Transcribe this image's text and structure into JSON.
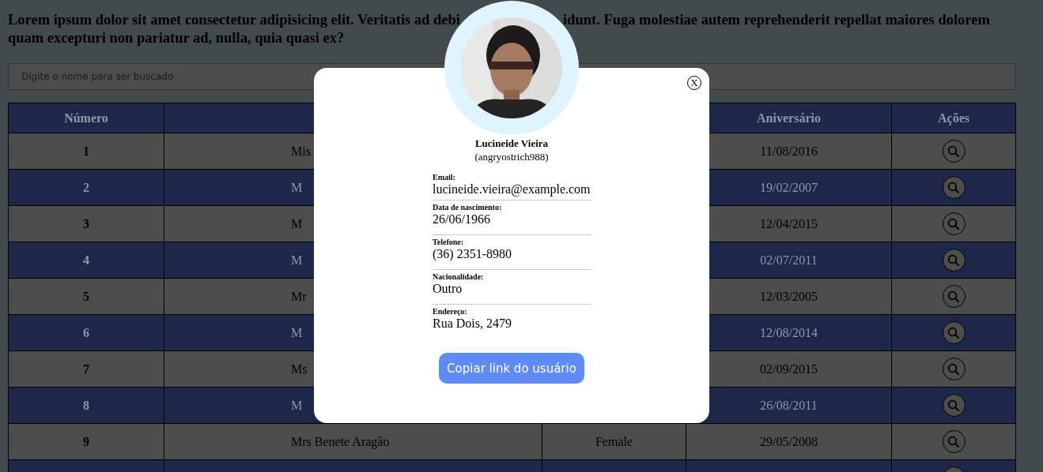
{
  "heading": {
    "before_avatar": "Lorem ipsum dolor sit amet consectetur adipisicing elit. Veritatis ad debi",
    "after_avatar": "idunt. Fuga molestiae autem reprehenderit repellat maiores dolorem",
    "second_line": "quam excepturi non pariatur ad, nulla, quia quasi ex?"
  },
  "search": {
    "placeholder": "Digite o nome para ser buscado"
  },
  "table": {
    "headers": {
      "number": "Número",
      "birthday": "Aniversário",
      "actions": "Ações"
    },
    "rows": [
      {
        "number": "1",
        "name": "Mis",
        "birthday": "11/08/2016"
      },
      {
        "number": "2",
        "name": "M",
        "birthday": "19/02/2007"
      },
      {
        "number": "3",
        "name": "M",
        "birthday": "12/04/2015"
      },
      {
        "number": "4",
        "name": "M",
        "birthday": "02/07/2011"
      },
      {
        "number": "5",
        "name": "Mr",
        "birthday": "12/03/2005"
      },
      {
        "number": "6",
        "name": "M",
        "birthday": "12/08/2014"
      },
      {
        "number": "7",
        "name": "Ms",
        "birthday": "02/09/2015"
      },
      {
        "number": "8",
        "name": "M",
        "birthday": "26/08/2011"
      },
      {
        "number": "9",
        "name": "Mrs Benete Aragão",
        "gender": "Female",
        "birthday": "29/05/2008"
      }
    ]
  },
  "modal": {
    "close_label": "X",
    "name": "Lucineide Vieira",
    "username": "(angryostrich988)",
    "fields": [
      {
        "label": "Email:",
        "value": "lucineide.vieira@example.com"
      },
      {
        "label": "Data de nascimento:",
        "value": "26/06/1966"
      },
      {
        "label": "Telefone:",
        "value": "(36) 2351-8980"
      },
      {
        "label": "Nacionalidade:",
        "value": "Outro"
      },
      {
        "label": "Endereço:",
        "value": "Rua Dois, 2479"
      }
    ],
    "button": "Copiar link do usuário"
  }
}
